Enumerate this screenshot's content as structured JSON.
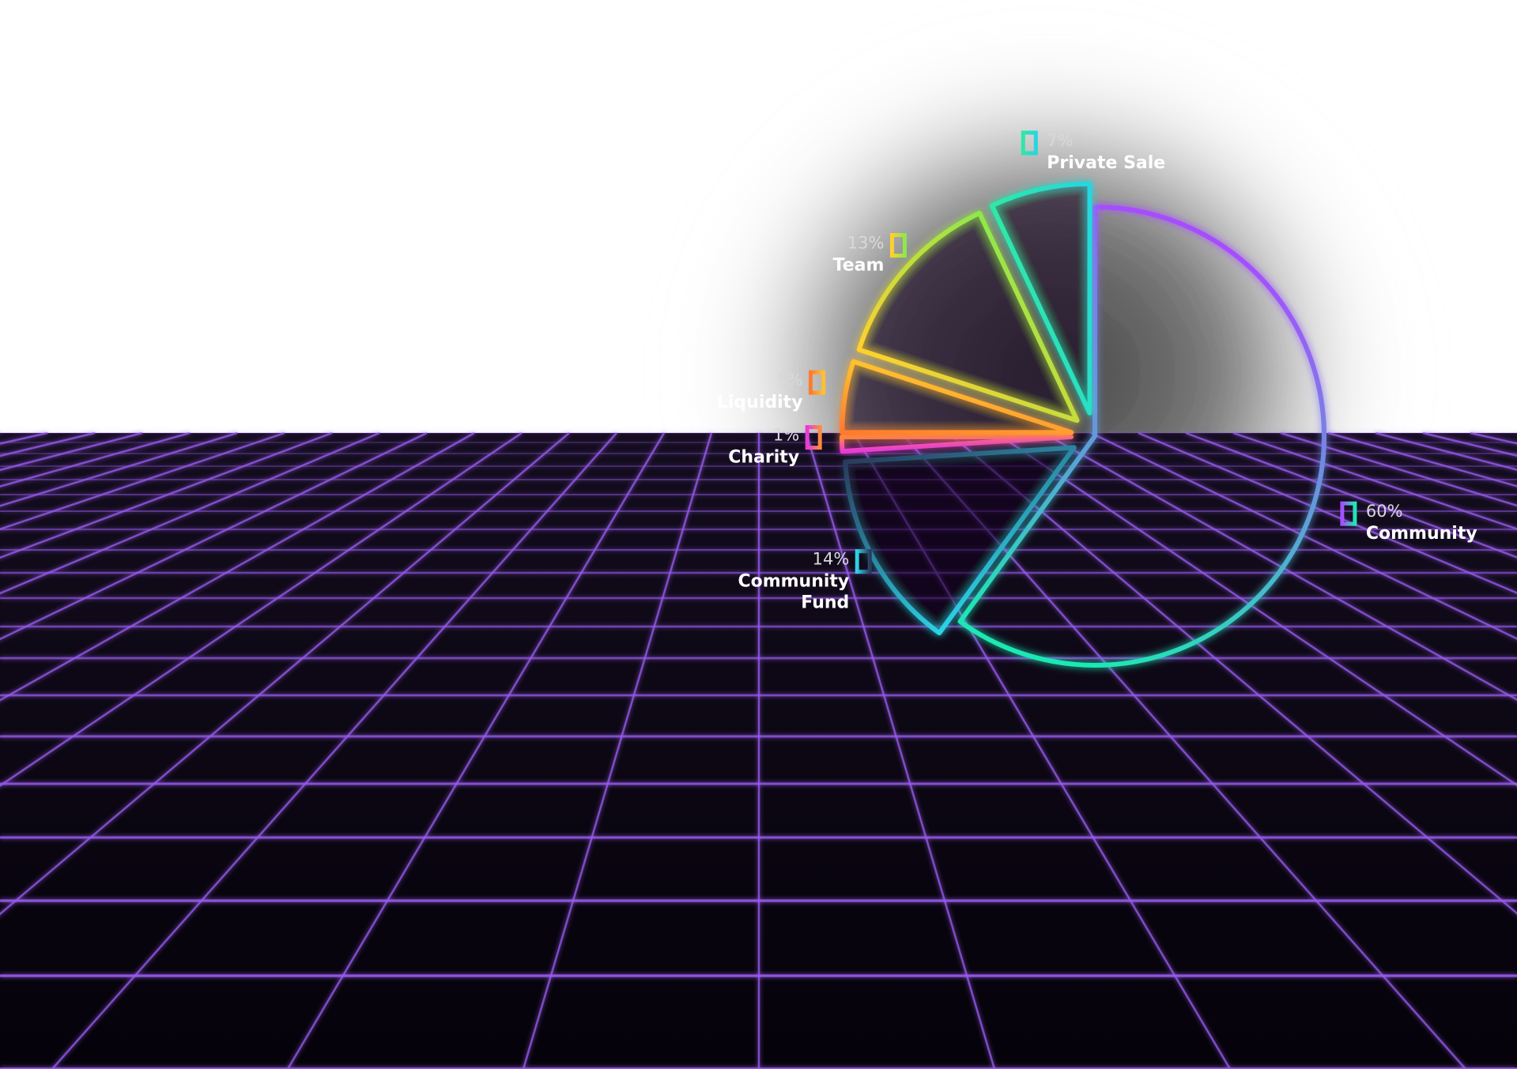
{
  "chart_data": {
    "type": "pie",
    "title": "",
    "start": "top",
    "direction": "clockwise",
    "slices": [
      {
        "name": "Community",
        "label_lines": [
          "Community"
        ],
        "value": 60,
        "percent_label": "60%",
        "color_start": "#a64dff",
        "color_end": "#1ee8b4",
        "exploded": false
      },
      {
        "name": "Community Fund",
        "label_lines": [
          "Community",
          "Fund"
        ],
        "value": 14,
        "percent_label": "14%",
        "color_start": "#2ad4e6",
        "color_end": "#2a3b5c",
        "exploded": true
      },
      {
        "name": "Charity",
        "label_lines": [
          "Charity"
        ],
        "value": 1,
        "percent_label": "1%",
        "color_start": "#e83ad8",
        "color_end": "#ff8a3d",
        "exploded": true
      },
      {
        "name": "Liquidity",
        "label_lines": [
          "Liquidity"
        ],
        "value": 5,
        "percent_label": "5%",
        "color_start": "#ff7a2e",
        "color_end": "#ffc22e",
        "exploded": true
      },
      {
        "name": "Team",
        "label_lines": [
          "Team"
        ],
        "value": 13,
        "percent_label": "13%",
        "color_start": "#ffd02e",
        "color_end": "#8ee84a",
        "exploded": true
      },
      {
        "name": "Private Sale",
        "label_lines": [
          "Private Sale"
        ],
        "value": 7,
        "percent_label": "7%",
        "color_start": "#2ee8a6",
        "color_end": "#27d6e0",
        "exploded": true
      }
    ]
  },
  "colors": {
    "background_top": "#ffffff",
    "floor": "#0b0612",
    "grid_line": "#9a5cf0"
  }
}
